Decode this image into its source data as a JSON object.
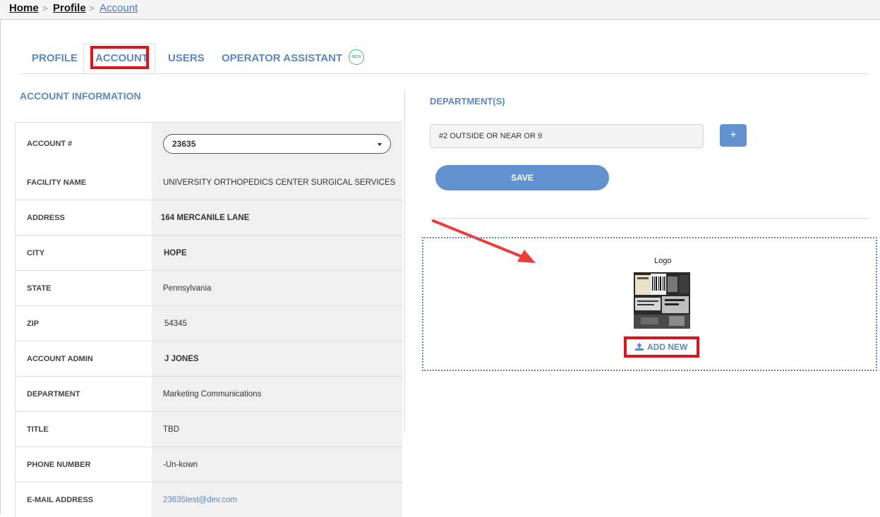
{
  "breadcrumb": {
    "home": "Home",
    "sep1": ">",
    "profile": "Profile",
    "sep2": ">",
    "account": "Account"
  },
  "tabs": [
    {
      "label": "PROFILE"
    },
    {
      "label": "ACCOUNT",
      "active": true
    },
    {
      "label": "USERS"
    },
    {
      "label": "OPERATOR ASSISTANT",
      "badge": "BETA"
    }
  ],
  "account_info": {
    "title": "ACCOUNT INFORMATION",
    "rows": [
      {
        "label": "ACCOUNT #",
        "value": "23635",
        "type": "select"
      },
      {
        "label": "FACILITY NAME",
        "value": "UNIVERSITY ORTHOPEDICS CENTER SURGICAL SERVICES"
      },
      {
        "label": "ADDRESS",
        "value": "164 MERCANILE LANE"
      },
      {
        "label": "CITY",
        "value": "HOPE"
      },
      {
        "label": "STATE",
        "value": "Pennsylvania"
      },
      {
        "label": "ZIP",
        "value": "54345"
      },
      {
        "label": "ACCOUNT ADMIN",
        "value": "J JONES"
      },
      {
        "label": "DEPARTMENT",
        "value": "Marketing Communications"
      },
      {
        "label": "TITLE",
        "value": "TBD"
      },
      {
        "label": "PHONE NUMBER",
        "value": "-Un-kown"
      },
      {
        "label": "E-MAIL ADDRESS",
        "value": "23635test@dev.com"
      }
    ]
  },
  "departments": {
    "title": "DEPARTMENT(S)",
    "input_value": "#2  OUTSIDE OR NEAR OR 9",
    "add_label": "+",
    "save_label": "SAVE"
  },
  "logo": {
    "caption": "Logo",
    "add_new_label": "ADD NEW"
  },
  "colors": {
    "accent": "#5b88c2",
    "button": "#6291cf",
    "highlight": "#e0121e",
    "beta": "#48b97a"
  },
  "icons": [
    "upload-icon",
    "caret-down-icon",
    "beta-badge-icon",
    "red-arrow-annotation"
  ]
}
